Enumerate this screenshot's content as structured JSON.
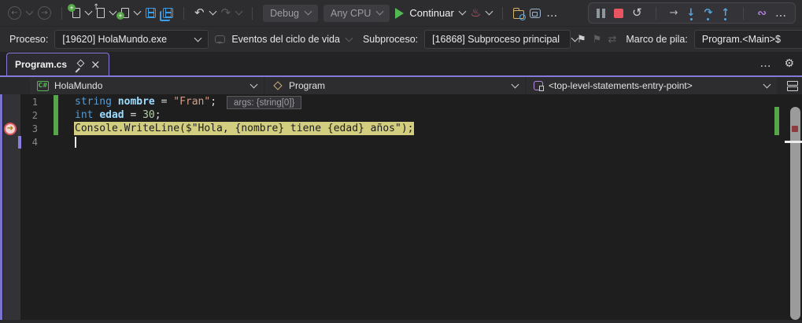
{
  "colors": {
    "accent": "#8579d9",
    "editor-bg": "#1e1e1e",
    "toolbar-bg": "#2d2d30",
    "keyword": "#569cd6",
    "variable": "#9cdcfe",
    "string": "#d69d85",
    "number": "#b5cea8",
    "highlight": "#d3ce7f",
    "change-green": "#57a64a",
    "stop-red": "#e85561",
    "step-blue": "#58a6e0",
    "save-blue": "#3b9eea",
    "run-green": "#53b853"
  },
  "icons": {
    "back": "←",
    "forward": "→",
    "undo": "↶",
    "redo": "↷",
    "restart": "↺",
    "next_statement": "→",
    "step_into": "↓",
    "step_over": "↷",
    "step_out": "↑",
    "parallel": "∾",
    "flag": "⚑",
    "gear": "⚙",
    "dots": "…",
    "close": "×",
    "hot_reload": "♨",
    "csharp_badge": "C#"
  },
  "toolbar": {
    "debug_config": "Debug",
    "platform": "Any CPU",
    "continue_label": "Continuar"
  },
  "debug_location": {
    "process_label": "Proceso:",
    "process_value": "[19620] HolaMundo.exe",
    "lifecycle_events_label": "Eventos del ciclo de vida",
    "thread_label": "Subproceso:",
    "thread_value": "[16868] Subproceso principal",
    "stack_frame_label": "Marco de pila:",
    "stack_frame_value": "Program.<Main>$"
  },
  "tab": {
    "title": "Program.cs"
  },
  "navbar": {
    "project": "HolaMundo",
    "type_name": "Program",
    "member": "<top-level-statements-entry-point>"
  },
  "editor": {
    "hint": "args: {string[0]}",
    "lines": [
      {
        "number": "1",
        "changed": true,
        "segments": [
          {
            "text": "string ",
            "cls": "kw"
          },
          {
            "text": "nombre",
            "cls": "var"
          },
          {
            "text": " = ",
            "cls": "pl"
          },
          {
            "text": "\"Fran\"",
            "cls": "str"
          },
          {
            "text": ";",
            "cls": "pl"
          }
        ]
      },
      {
        "number": "2",
        "changed": true,
        "segments": [
          {
            "text": "int ",
            "cls": "kw"
          },
          {
            "text": "edad",
            "cls": "var"
          },
          {
            "text": " = ",
            "cls": "pl"
          },
          {
            "text": "30",
            "cls": "num"
          },
          {
            "text": ";",
            "cls": "pl"
          }
        ]
      },
      {
        "number": "3",
        "changed": true,
        "current": true,
        "segments": [
          {
            "text": "Console.WriteLine($\"Hola, {nombre} tiene {edad} años\");",
            "cls": "cur"
          }
        ]
      },
      {
        "number": "4",
        "changed": false,
        "caret": true,
        "segments": []
      }
    ]
  }
}
